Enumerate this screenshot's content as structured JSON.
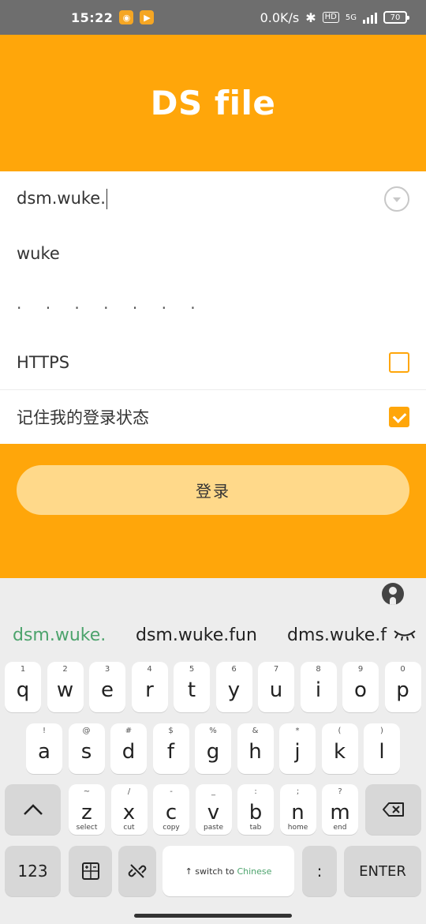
{
  "status_bar": {
    "time": "15:22",
    "net_speed": "0.0K/s",
    "hd": "HD",
    "network": "5G",
    "battery": "70"
  },
  "app": {
    "title": "DS file"
  },
  "form": {
    "server": "dsm.wuke.",
    "username": "wuke",
    "password_mask": "· · · · · · ·",
    "https_label": "HTTPS",
    "https_checked": false,
    "remember_label": "记住我的登录状态",
    "remember_checked": true,
    "login_label": "登录"
  },
  "keyboard": {
    "suggestions": [
      "dsm.wuke.",
      "dsm.wuke.fun",
      "dms.wuke.f"
    ],
    "row1": [
      {
        "main": "q",
        "hint": "1"
      },
      {
        "main": "w",
        "hint": "2"
      },
      {
        "main": "e",
        "hint": "3"
      },
      {
        "main": "r",
        "hint": "4"
      },
      {
        "main": "t",
        "hint": "5"
      },
      {
        "main": "y",
        "hint": "6"
      },
      {
        "main": "u",
        "hint": "7"
      },
      {
        "main": "i",
        "hint": "8"
      },
      {
        "main": "o",
        "hint": "9"
      },
      {
        "main": "p",
        "hint": "0"
      }
    ],
    "row2": [
      {
        "main": "a",
        "hint": "!"
      },
      {
        "main": "s",
        "hint": "@"
      },
      {
        "main": "d",
        "hint": "#"
      },
      {
        "main": "f",
        "hint": "$"
      },
      {
        "main": "g",
        "hint": "%"
      },
      {
        "main": "h",
        "hint": "&"
      },
      {
        "main": "j",
        "hint": "*"
      },
      {
        "main": "k",
        "hint": "("
      },
      {
        "main": "l",
        "hint": ")"
      }
    ],
    "row3": [
      {
        "main": "z",
        "hint": "~",
        "sub": "select"
      },
      {
        "main": "x",
        "hint": "/",
        "sub": "cut"
      },
      {
        "main": "c",
        "hint": "-",
        "sub": "copy"
      },
      {
        "main": "v",
        "hint": "_",
        "sub": "paste"
      },
      {
        "main": "b",
        "hint": ":",
        "sub": "tab"
      },
      {
        "main": "n",
        "hint": ";",
        "sub": "home"
      },
      {
        "main": "m",
        "hint": "?",
        "sub": "end"
      }
    ],
    "num_label": "123",
    "space_prefix": "↑ switch to ",
    "space_accent": "Chinese",
    "punct_label": ":",
    "enter_label": "ENTER"
  }
}
